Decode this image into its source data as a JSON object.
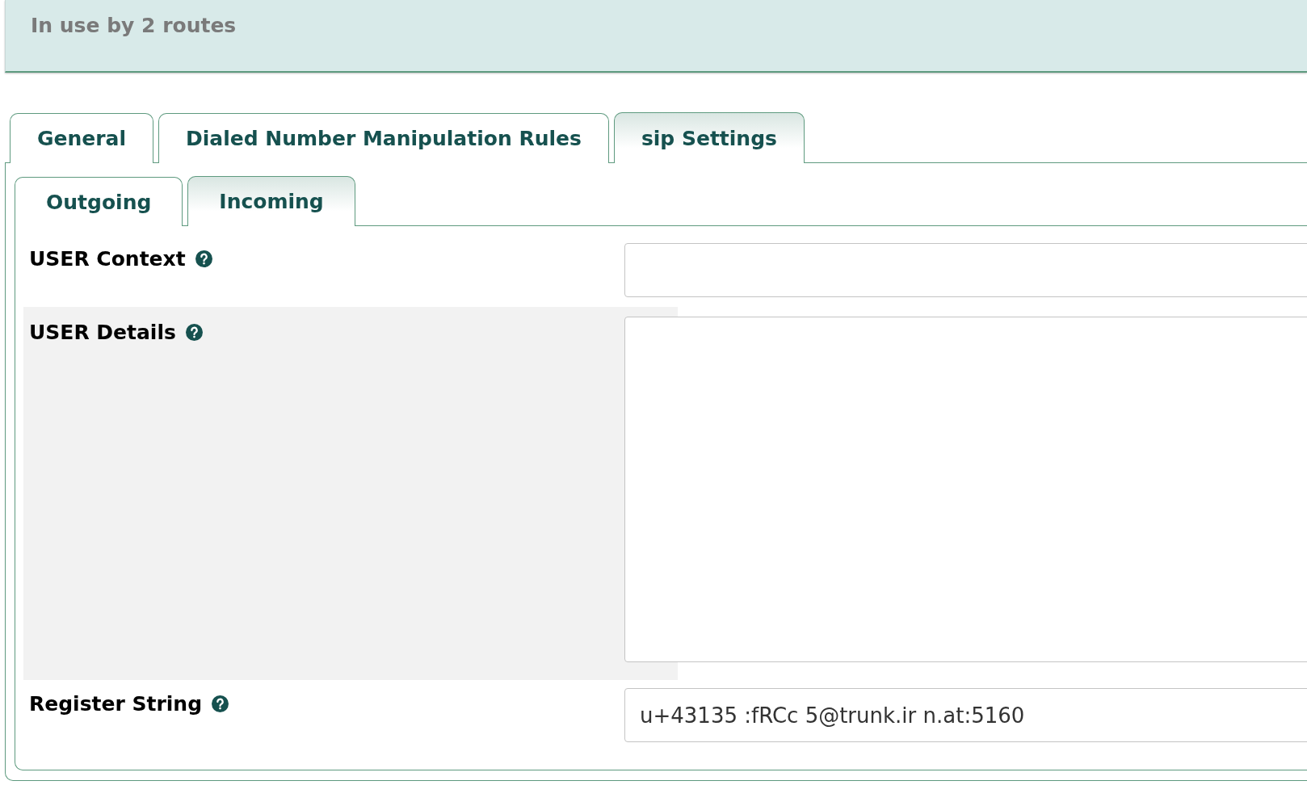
{
  "banner": {
    "text": "In use by 2 routes"
  },
  "tabs": [
    {
      "label": "General",
      "selected": false
    },
    {
      "label": "Dialed Number Manipulation Rules",
      "selected": false
    },
    {
      "label": "sip Settings",
      "selected": true
    }
  ],
  "subtabs": [
    {
      "label": "Outgoing",
      "selected": false
    },
    {
      "label": "Incoming",
      "selected": true
    }
  ],
  "fields": [
    {
      "label": "USER Context",
      "kind": "input",
      "shaded": false
    },
    {
      "label": "USER Details",
      "kind": "textarea",
      "shaded": true
    },
    {
      "label": "Register String",
      "kind": "input",
      "shaded": false,
      "value": "u+43135 :fRCc 5@trunk.ir n.at:5160"
    }
  ]
}
